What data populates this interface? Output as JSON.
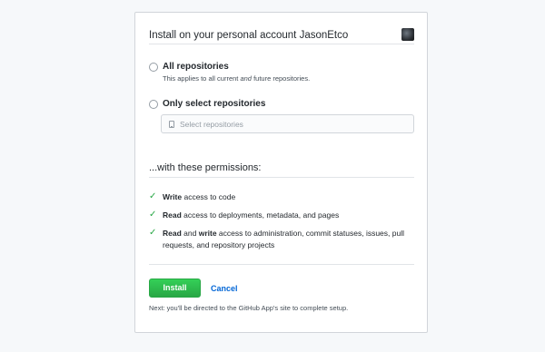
{
  "header": {
    "title": "Install on your personal account JasonEtco",
    "avatar": "user-avatar"
  },
  "repository_options": [
    {
      "label": "All repositories",
      "note_prefix": "This applies to all current ",
      "note_em": "and",
      "note_suffix": " future repositories.",
      "selected": false
    },
    {
      "label": "Only select repositories",
      "selected": false
    }
  ],
  "select": {
    "placeholder": "Select repositories",
    "icon": "repo-icon"
  },
  "permissions": {
    "title": "...with these permissions:",
    "items": [
      {
        "bold1": "Write",
        "text": " access to code"
      },
      {
        "bold1": "Read",
        "text": " access to deployments, metadata, and pages"
      },
      {
        "bold1": "Read",
        "middle": " and ",
        "bold2": "write",
        "text": " access to administration, commit statuses, issues, pull requests, and repository projects"
      }
    ],
    "check_glyph": "✓"
  },
  "actions": {
    "install_label": "Install",
    "cancel_label": "Cancel"
  },
  "footnote": "Next: you'll be directed to the GitHub App's site to complete setup.",
  "colors": {
    "accent": "#28a745",
    "link": "#0366d6"
  }
}
